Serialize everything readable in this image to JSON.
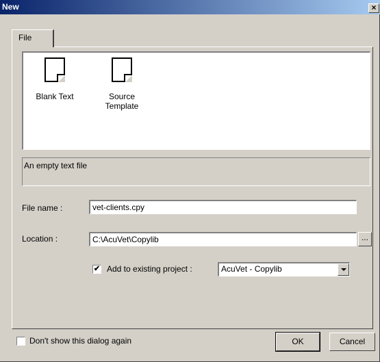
{
  "window": {
    "title": "New",
    "close_glyph": "×"
  },
  "tabs": [
    {
      "label": "File"
    }
  ],
  "templates": [
    {
      "label_line1": "Blank Text",
      "label_line2": "",
      "icon": "document-icon"
    },
    {
      "label_line1": "Source",
      "label_line2": "Template",
      "icon": "document-icon"
    }
  ],
  "description": "An empty text file",
  "file_name": {
    "label": "File name :",
    "value": "vet-clients.cpy"
  },
  "location": {
    "label": "Location :",
    "value": "C:\\AcuVet\\Copylib",
    "browse_label": "..."
  },
  "add_to_project": {
    "label": "Add to existing project :",
    "checked_glyph": "✔",
    "value": "AcuVet - Copylib"
  },
  "dont_show": {
    "label": "Don't show this dialog again",
    "checked": false
  },
  "buttons": {
    "ok": "OK",
    "cancel": "Cancel"
  }
}
